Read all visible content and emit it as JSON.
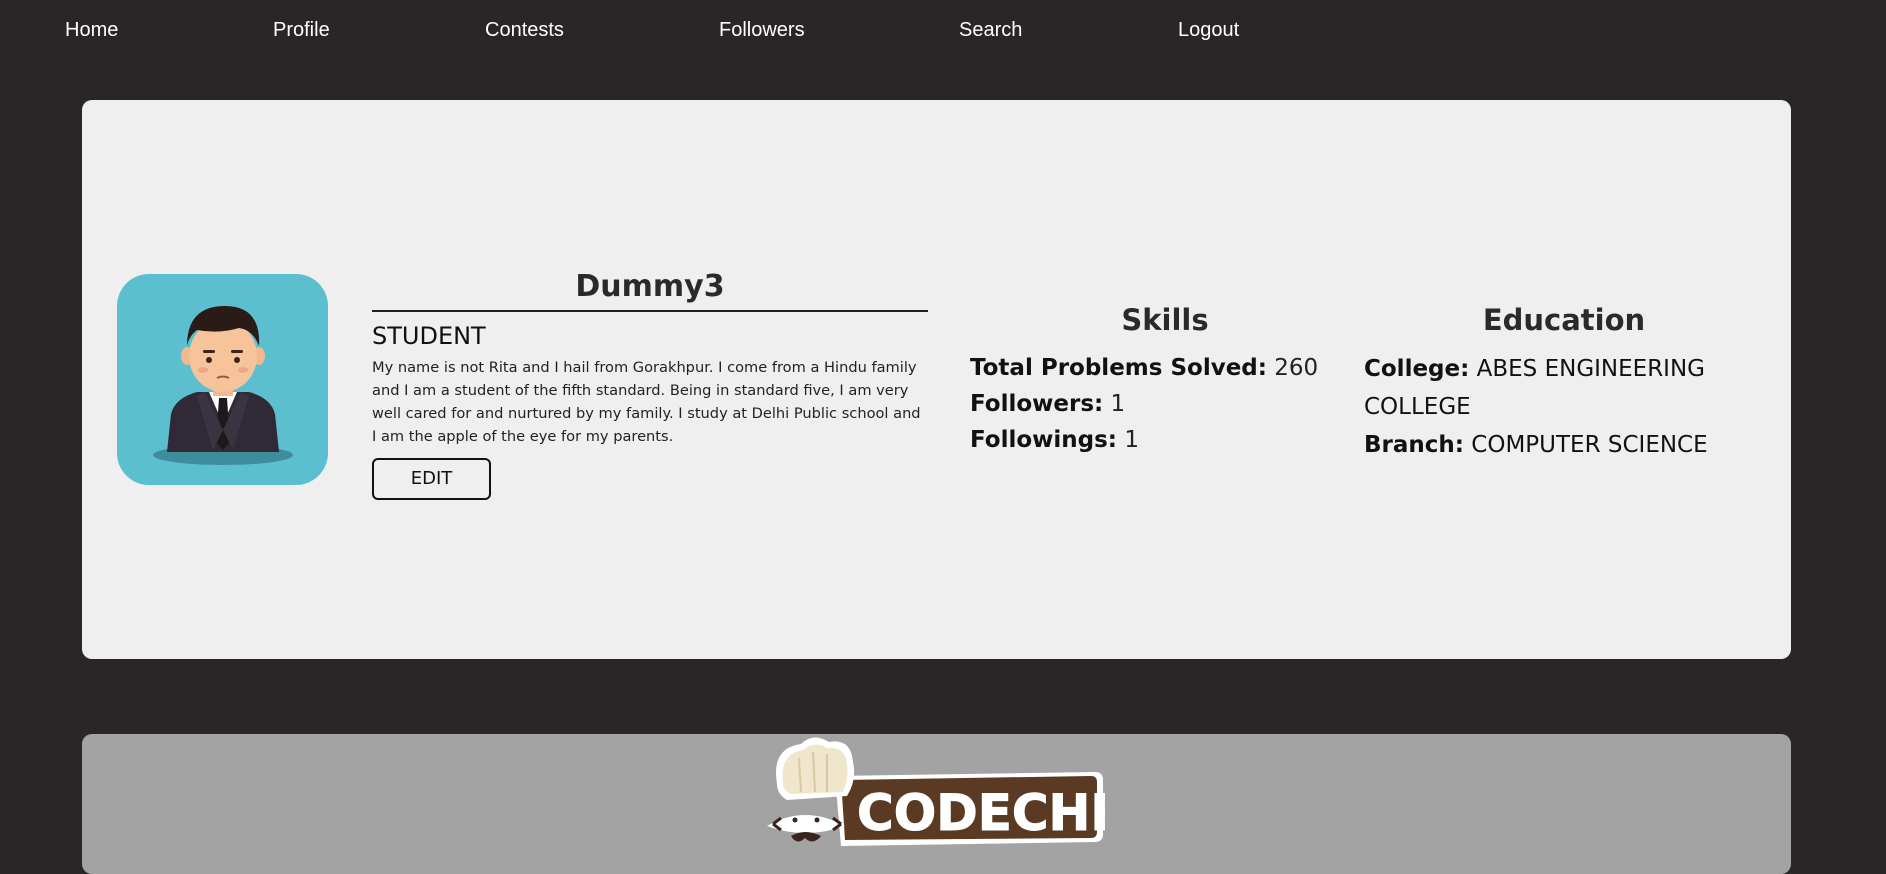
{
  "nav": {
    "home": "Home",
    "profile": "Profile",
    "contests": "Contests",
    "followers": "Followers",
    "search": "Search",
    "logout": "Logout"
  },
  "profile": {
    "username": "Dummy3",
    "role": "STUDENT",
    "bio": "My name is not Rita and I hail from Gorakhpur. I come from a Hindu family and I am a student of the fifth standard. Being in standard five, I am very well cared for and nurtured by my family. I study at Delhi Public school and I am the apple of the eye for my parents.",
    "edit_label": "EDIT",
    "avatar_icon": "user-avatar-icon"
  },
  "skills": {
    "title": "Skills",
    "problems_label": "Total Problems Solved:",
    "problems_value": "260",
    "followers_label": "Followers:",
    "followers_value": "1",
    "followings_label": "Followings:",
    "followings_value": "1"
  },
  "education": {
    "title": "Education",
    "college_label": "College:",
    "college_value": "ABES ENGINEERING COLLEGE",
    "branch_label": "Branch:",
    "branch_value": "COMPUTER SCIENCE"
  },
  "footer": {
    "logo_text": "CODECHEF",
    "logo_icon": "chef-hat-icon"
  },
  "colors": {
    "background": "#2a2526",
    "card": "#efefef",
    "avatar_bg": "#5bbfd0",
    "footer_card": "#a3a3a3",
    "logo_brown": "#5a3a22"
  }
}
